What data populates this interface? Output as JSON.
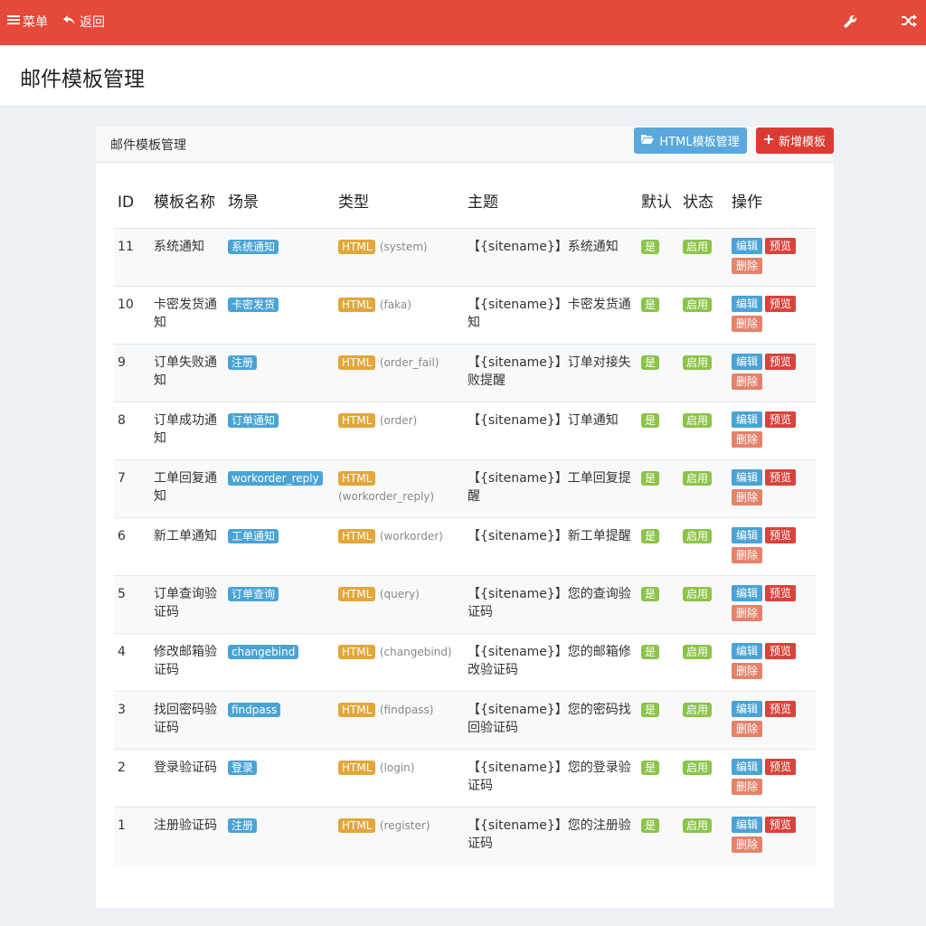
{
  "topbar": {
    "menu_label": "菜单",
    "back_label": "返回"
  },
  "page": {
    "title": "邮件模板管理"
  },
  "panel": {
    "title": "邮件模板管理",
    "html_btn": "HTML模板管理",
    "new_btn": "新增模板"
  },
  "table": {
    "headers": {
      "id": "ID",
      "name": "模板名称",
      "scene": "场景",
      "type": "类型",
      "subject": "主题",
      "default": "默认",
      "status": "状态",
      "ops": "操作"
    },
    "op_labels": {
      "edit": "编辑",
      "preview": "预览",
      "delete": "删除"
    },
    "rows": [
      {
        "id": "11",
        "name": "系统通知",
        "scene": "系统通知",
        "type": "HTML",
        "type_code": "(system)",
        "subject": "【{sitename}】系统通知",
        "default": "是",
        "status": "启用"
      },
      {
        "id": "10",
        "name": "卡密发货通知",
        "scene": "卡密发货",
        "type": "HTML",
        "type_code": "(faka)",
        "subject": "【{sitename}】卡密发货通知",
        "default": "是",
        "status": "启用"
      },
      {
        "id": "9",
        "name": "订单失败通知",
        "scene": "注册",
        "type": "HTML",
        "type_code": "(order_fail)",
        "subject": "【{sitename}】订单对接失败提醒",
        "default": "是",
        "status": "启用"
      },
      {
        "id": "8",
        "name": "订单成功通知",
        "scene": "订单通知",
        "type": "HTML",
        "type_code": "(order)",
        "subject": "【{sitename}】订单通知",
        "default": "是",
        "status": "启用"
      },
      {
        "id": "7",
        "name": "工单回复通知",
        "scene": "workorder_reply",
        "type": "HTML",
        "type_code": "(workorder_reply)",
        "subject": "【{sitename}】工单回复提醒",
        "default": "是",
        "status": "启用"
      },
      {
        "id": "6",
        "name": "新工单通知",
        "scene": "工单通知",
        "type": "HTML",
        "type_code": "(workorder)",
        "subject": "【{sitename}】新工单提醒",
        "default": "是",
        "status": "启用"
      },
      {
        "id": "5",
        "name": "订单查询验证码",
        "scene": "订单查询",
        "type": "HTML",
        "type_code": "(query)",
        "subject": "【{sitename}】您的查询验证码",
        "default": "是",
        "status": "启用"
      },
      {
        "id": "4",
        "name": "修改邮箱验证码",
        "scene": "changebind",
        "type": "HTML",
        "type_code": "(changebind)",
        "subject": "【{sitename}】您的邮箱修改验证码",
        "default": "是",
        "status": "启用"
      },
      {
        "id": "3",
        "name": "找回密码验证码",
        "scene": "findpass",
        "type": "HTML",
        "type_code": "(findpass)",
        "subject": "【{sitename}】您的密码找回验证码",
        "default": "是",
        "status": "启用"
      },
      {
        "id": "2",
        "name": "登录验证码",
        "scene": "登录",
        "type": "HTML",
        "type_code": "(login)",
        "subject": "【{sitename}】您的登录验证码",
        "default": "是",
        "status": "启用"
      },
      {
        "id": "1",
        "name": "注册验证码",
        "scene": "注册",
        "type": "HTML",
        "type_code": "(register)",
        "subject": "【{sitename}】您的注册验证码",
        "default": "是",
        "status": "启用"
      }
    ]
  },
  "colors": {
    "topbar": "#e5493a",
    "info": "#4aa3d6",
    "warning": "#e2a63a",
    "success": "#8cc34a",
    "danger": "#d9433b"
  }
}
